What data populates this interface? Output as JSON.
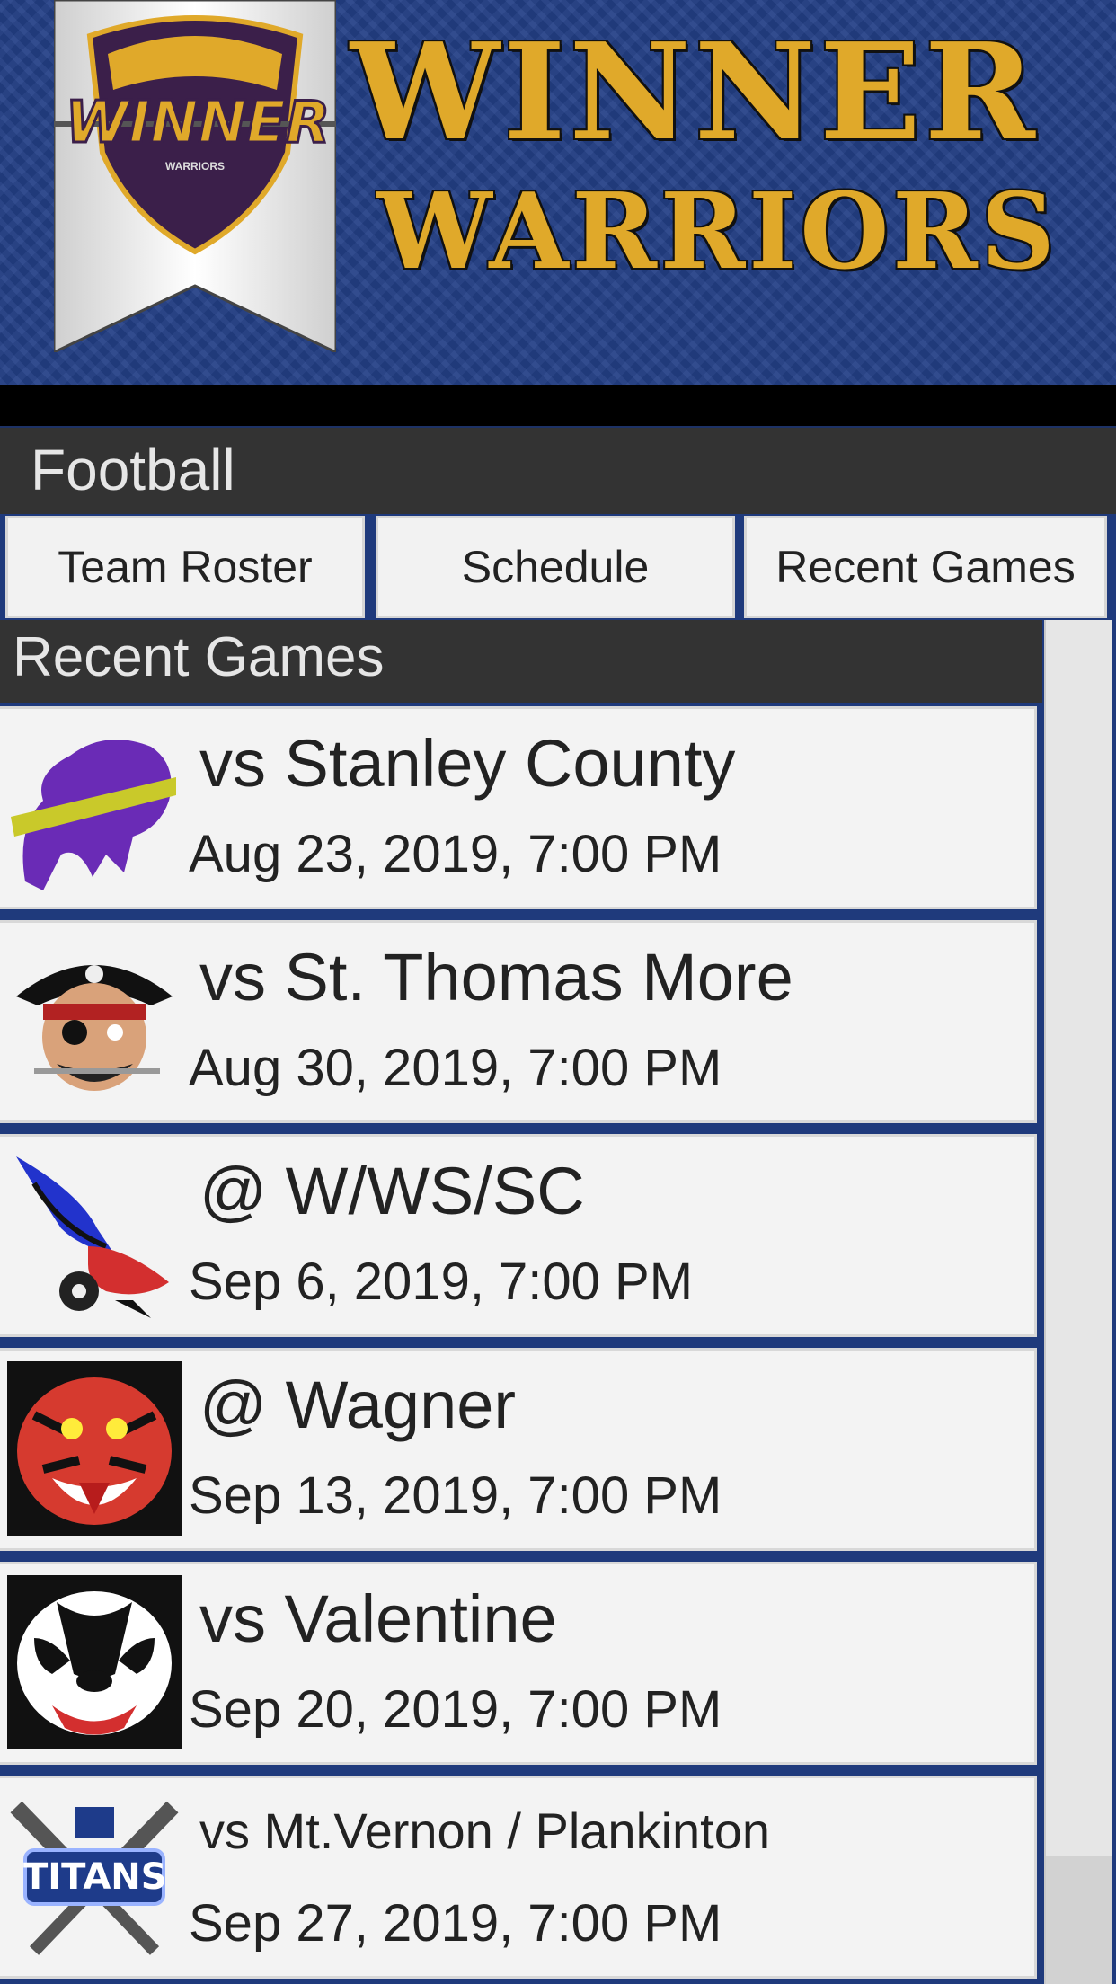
{
  "header": {
    "logo_text": "WINNER",
    "logo_subtext": "WARRIORS",
    "title_line1": "WINNER",
    "title_line2": "WARRIORS",
    "colors": {
      "navy": "#233f86",
      "gold": "#e0a92a",
      "purple": "#3b1f4a"
    }
  },
  "sport": {
    "title": "Football"
  },
  "tabs": [
    {
      "label": "Team Roster"
    },
    {
      "label": "Schedule"
    },
    {
      "label": "Recent Games"
    }
  ],
  "section": {
    "title": "Recent Games"
  },
  "games": [
    {
      "opponent": "vs Stanley County",
      "date": "Aug 23, 2019, 7:00 PM",
      "logo_icon": "buffalo-logo-icon"
    },
    {
      "opponent": "vs St. Thomas More",
      "date": "Aug 30, 2019, 7:00 PM",
      "logo_icon": "pirate-logo-icon"
    },
    {
      "opponent": "@ W/WS/SC",
      "date": "Sep 6, 2019, 7:00 PM",
      "logo_icon": "eagle-logo-icon"
    },
    {
      "opponent": "@ Wagner",
      "date": "Sep 13, 2019, 7:00 PM",
      "logo_icon": "tiger-logo-icon"
    },
    {
      "opponent": "vs Valentine",
      "date": "Sep 20, 2019, 7:00 PM",
      "logo_icon": "badger-logo-icon"
    },
    {
      "opponent": "vs Mt.Vernon / Plankinton",
      "date": "Sep 27, 2019, 7:00 PM",
      "logo_icon": "titans-logo-icon",
      "logo_text": "TITANS"
    }
  ]
}
